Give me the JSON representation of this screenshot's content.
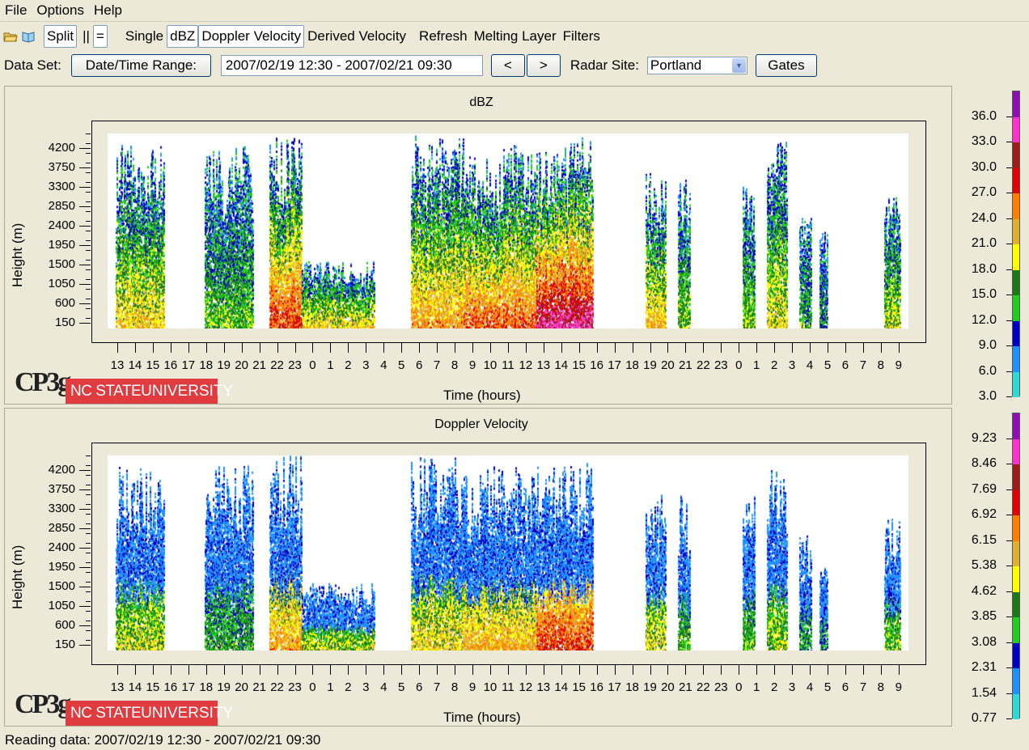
{
  "menu": [
    "File",
    "Options",
    "Help"
  ],
  "toolbar": {
    "split": "Split",
    "parallel": "||",
    "equal": "=",
    "single": "Single",
    "dbz": "dBZ",
    "doppler": "Doppler Velocity",
    "derived": "Derived Velocity",
    "refresh": "Refresh",
    "melting": "Melting Layer",
    "filters": "Filters"
  },
  "dataset": {
    "label": "Data Set:",
    "range_button": "Date/Time Range:",
    "range_value": "2007/02/19 12:30 - 2007/02/21 09:30",
    "prev": "<",
    "next": ">",
    "site_label": "Radar Site:",
    "site_value": "Portland",
    "gates": "Gates"
  },
  "panels": [
    {
      "title": "dBZ",
      "ylabel": "Height (m)",
      "xlabel": "Time (hours)",
      "yticks": [
        "4200",
        "3750",
        "3300",
        "2850",
        "2400",
        "1950",
        "1500",
        "1050",
        "600",
        "150"
      ],
      "colorbar_labels": [
        "36.0",
        "33.0",
        "30.0",
        "27.0",
        "24.0",
        "21.0",
        "18.0",
        "15.0",
        "12.0",
        "9.0",
        "6.0",
        "3.0"
      ]
    },
    {
      "title": "Doppler Velocity",
      "ylabel": "Height (m)",
      "xlabel": "Time (hours)",
      "yticks": [
        "4200",
        "3750",
        "3300",
        "2850",
        "2400",
        "1950",
        "1500",
        "1050",
        "600",
        "150"
      ],
      "colorbar_labels": [
        "9.23",
        "8.46",
        "7.69",
        "6.92",
        "6.15",
        "5.38",
        "4.62",
        "3.85",
        "3.08",
        "2.31",
        "1.54",
        "0.77"
      ]
    }
  ],
  "xticks": [
    "13",
    "14",
    "15",
    "16",
    "17",
    "18",
    "19",
    "20",
    "21",
    "22",
    "23",
    "0",
    "1",
    "2",
    "3",
    "4",
    "5",
    "6",
    "7",
    "8",
    "9",
    "10",
    "11",
    "12",
    "13",
    "14",
    "15",
    "16",
    "17",
    "18",
    "19",
    "20",
    "21",
    "22",
    "23",
    "0",
    "1",
    "2",
    "3",
    "4",
    "5",
    "6",
    "7",
    "8",
    "9"
  ],
  "colorbar_colors": [
    "#8b10b0",
    "#ff33cc",
    "#9c1c1c",
    "#e00000",
    "#ff8000",
    "#e0b030",
    "#ffff00",
    "#1a7a1a",
    "#22cc22",
    "#0000c0",
    "#2090ff",
    "#30d8d8"
  ],
  "logo": {
    "cpg": "CP3g",
    "ncsu_bold": "NC STATE",
    "ncsu_rest": " UNIVERSITY"
  },
  "status": "Reading data: 2007/02/19 12:30 - 2007/02/21 09:30"
}
